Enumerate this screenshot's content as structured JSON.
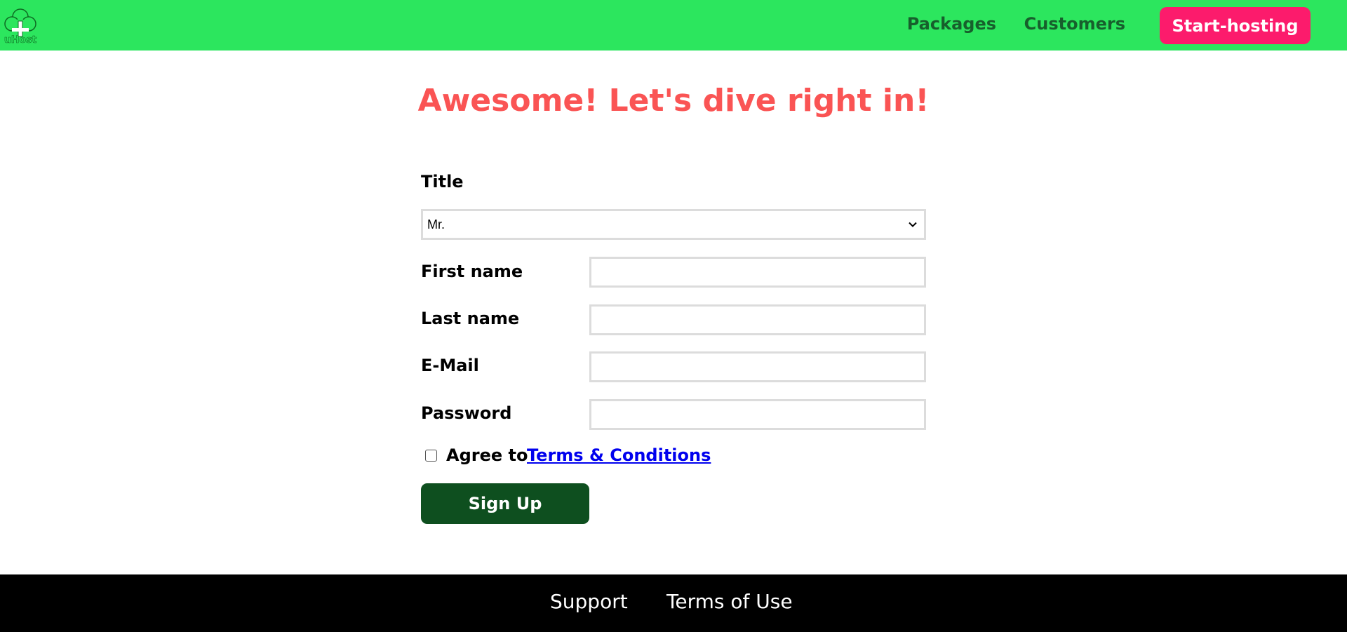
{
  "header": {
    "logo_text": "uHost",
    "logo_icon": "tree-icon",
    "nav": {
      "packages": "Packages",
      "customers": "Customers"
    },
    "cta_label": "Start-hosting"
  },
  "main": {
    "title": "Awesome! Let's dive right in!",
    "form": {
      "title_label": "Title",
      "title_value": "Mr.",
      "first_name_label": "First name",
      "first_name_value": "",
      "last_name_label": "Last name",
      "last_name_value": "",
      "email_label": "E-Mail",
      "email_value": "",
      "password_label": "Password",
      "password_value": "",
      "agree_text": "Agree to",
      "terms_link": "Terms & Conditions",
      "agree_checked": false,
      "submit_label": "Sign Up"
    }
  },
  "footer": {
    "support": "Support",
    "terms_of_use": "Terms of Use"
  },
  "colors": {
    "header_bg": "#2ce65e",
    "nav_text": "#175f2c",
    "cta_bg": "#fc1b6c",
    "title": "#fa5454",
    "submit_bg": "#0e4f1f",
    "footer_bg": "#000000",
    "link": "#0000ee"
  }
}
